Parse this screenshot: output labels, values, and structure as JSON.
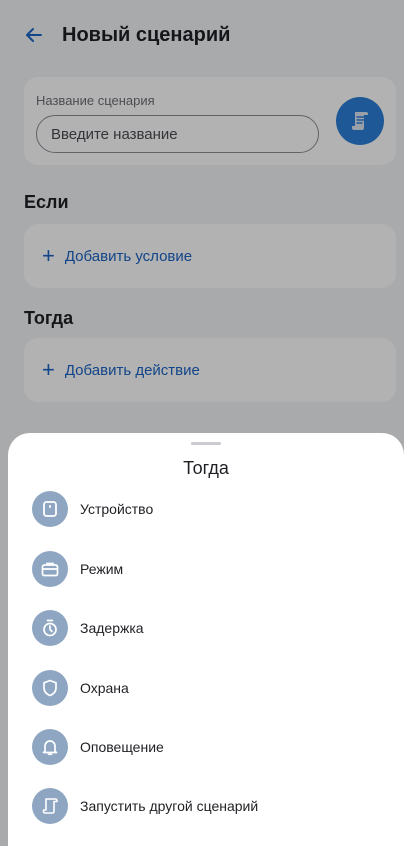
{
  "header": {
    "title": "Новый сценарий"
  },
  "scenario": {
    "name_label": "Название сценария",
    "name_placeholder": "Введите название",
    "name_value": ""
  },
  "if_section": {
    "title": "Если",
    "add_label": "Добавить условие"
  },
  "then_section": {
    "title": "Тогда",
    "add_label": "Добавить действие"
  },
  "sheet": {
    "title": "Тогда",
    "items": [
      {
        "label": "Устройство",
        "icon": "device-icon"
      },
      {
        "label": "Режим",
        "icon": "briefcase-icon"
      },
      {
        "label": "Задержка",
        "icon": "stopwatch-icon"
      },
      {
        "label": "Охрана",
        "icon": "shield-icon"
      },
      {
        "label": "Оповещение",
        "icon": "bell-icon"
      },
      {
        "label": "Запустить другой сценарий",
        "icon": "scroll-icon"
      }
    ]
  },
  "colors": {
    "accent": "#1b63c5",
    "avatar": "#2b7ed8",
    "menu_icon_bg": "#8ea6c2",
    "background": "#f3f4f7"
  }
}
